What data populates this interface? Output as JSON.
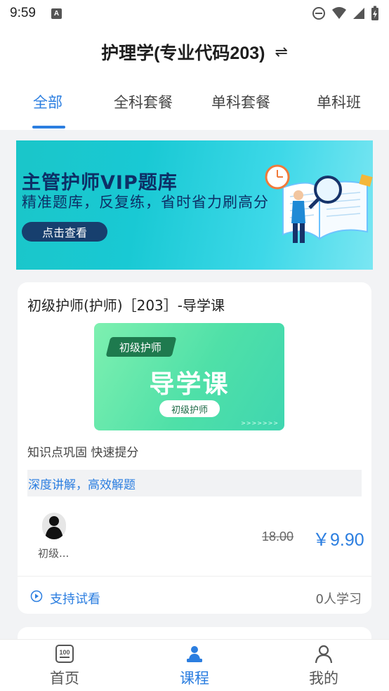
{
  "status_bar": {
    "time": "9:59",
    "notification_icon": "a-icon",
    "icons": [
      "dnd-icon",
      "wifi-icon",
      "signal-icon",
      "battery-charging-icon"
    ]
  },
  "header": {
    "title": "护理学(专业代码203)",
    "switch_icon": "switch-arrows-icon"
  },
  "tabs": [
    {
      "label": "全部",
      "active": true
    },
    {
      "label": "全科套餐",
      "active": false
    },
    {
      "label": "单科套餐",
      "active": false
    },
    {
      "label": "单科班",
      "active": false
    }
  ],
  "banner": {
    "title": "主管护师VIP题库",
    "subtitle": "精准题库，反复练，省时省力刷高分",
    "button_label": "点击查看"
  },
  "course": {
    "title": "初级护师(护师)［203］-导学课",
    "cover": {
      "tag": "初级护师",
      "main": "导学课",
      "pill": "初级护师"
    },
    "description": "知识点巩固 快速提分",
    "highlight": "深度讲解，高效解题",
    "teacher_name": "初级...",
    "price_original": "18.00",
    "price_current": "￥9.90",
    "trial_label": "支持试看",
    "learners": "0人学习"
  },
  "bottom_nav": [
    {
      "label": "首页",
      "icon": "home-100-icon",
      "active": false
    },
    {
      "label": "课程",
      "icon": "course-teacher-icon",
      "active": true
    },
    {
      "label": "我的",
      "icon": "profile-icon",
      "active": false
    }
  ],
  "colors": {
    "accent": "#2b7ee0",
    "banner_text": "#0d2f66",
    "cover_green": "#4fe0a8"
  }
}
